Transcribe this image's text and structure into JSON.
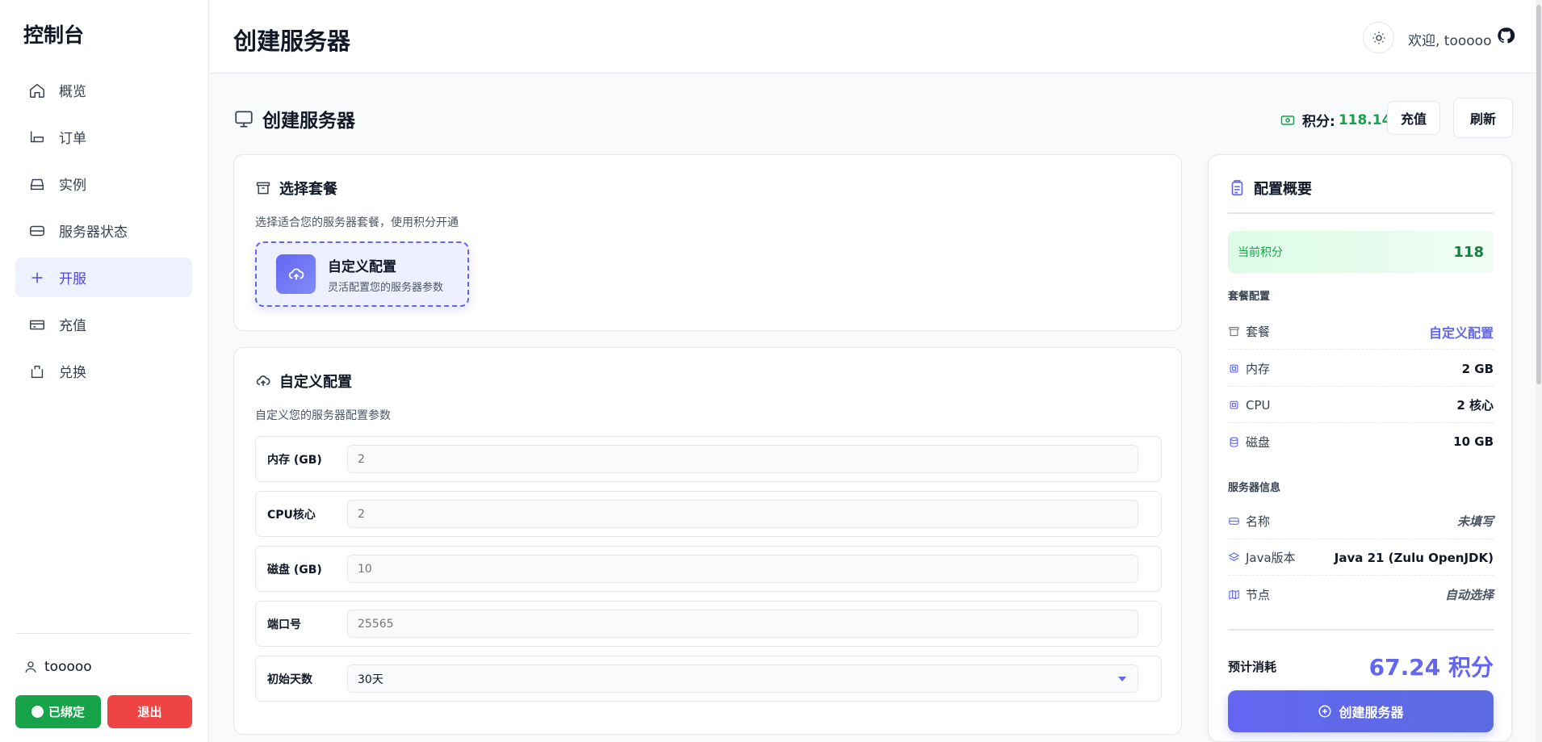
{
  "sidebar": {
    "brand": "控制台",
    "items": [
      {
        "label": "概览",
        "icon": "home-icon"
      },
      {
        "label": "订单",
        "icon": "order-icon"
      },
      {
        "label": "实例",
        "icon": "instance-icon"
      },
      {
        "label": "服务器状态",
        "icon": "server-status-icon"
      },
      {
        "label": "开服",
        "icon": "plus-icon"
      },
      {
        "label": "充值",
        "icon": "wallet-icon"
      },
      {
        "label": "兑换",
        "icon": "redeem-icon"
      }
    ],
    "active_item": "开服",
    "username": "tooooo",
    "bound_label": "已绑定",
    "logout_label": "退出"
  },
  "header": {
    "title": "创建服务器",
    "welcome": "欢迎, tooooo"
  },
  "page": {
    "heading": "创建服务器",
    "points_label": "积分:",
    "points_value": "118.14",
    "recharge_label": "充值",
    "refresh_label": "刷新"
  },
  "plan_card": {
    "title": "选择套餐",
    "desc": "选择适合您的服务器套餐，使用积分开通",
    "option": {
      "name": "自定义配置",
      "sub": "灵活配置您的服务器参数"
    }
  },
  "custom_card": {
    "title": "自定义配置",
    "desc": "自定义您的服务器配置参数",
    "fields": [
      {
        "label": "内存 (GB)",
        "placeholder": "2"
      },
      {
        "label": "CPU核心",
        "placeholder": "2"
      },
      {
        "label": "磁盘 (GB)",
        "placeholder": "10"
      },
      {
        "label": "端口号",
        "placeholder": "25565"
      }
    ],
    "days": {
      "label": "初始天数",
      "selected": "30天"
    }
  },
  "summary": {
    "title": "配置概要",
    "current_points_label": "当前积分",
    "current_points_value": "118",
    "plan_section": "套餐配置",
    "plan_rows": [
      {
        "key": "套餐",
        "value": "自定义配置"
      },
      {
        "key": "内存",
        "value": "2 GB"
      },
      {
        "key": "CPU",
        "value": "2 核心"
      },
      {
        "key": "磁盘",
        "value": "10 GB"
      }
    ],
    "info_section": "服务器信息",
    "info_rows": [
      {
        "key": "名称",
        "value": "未填写"
      },
      {
        "key": "Java版本",
        "value": "Java 21 (Zulu OpenJDK)"
      },
      {
        "key": "节点",
        "value": "自动选择"
      }
    ],
    "estimate_label": "预计消耗",
    "estimate_value": "67.24 积分",
    "create_label": "创建服务器"
  },
  "colors": {
    "accent": "#6366f1",
    "success": "#16a34a",
    "danger": "#ef4444"
  }
}
